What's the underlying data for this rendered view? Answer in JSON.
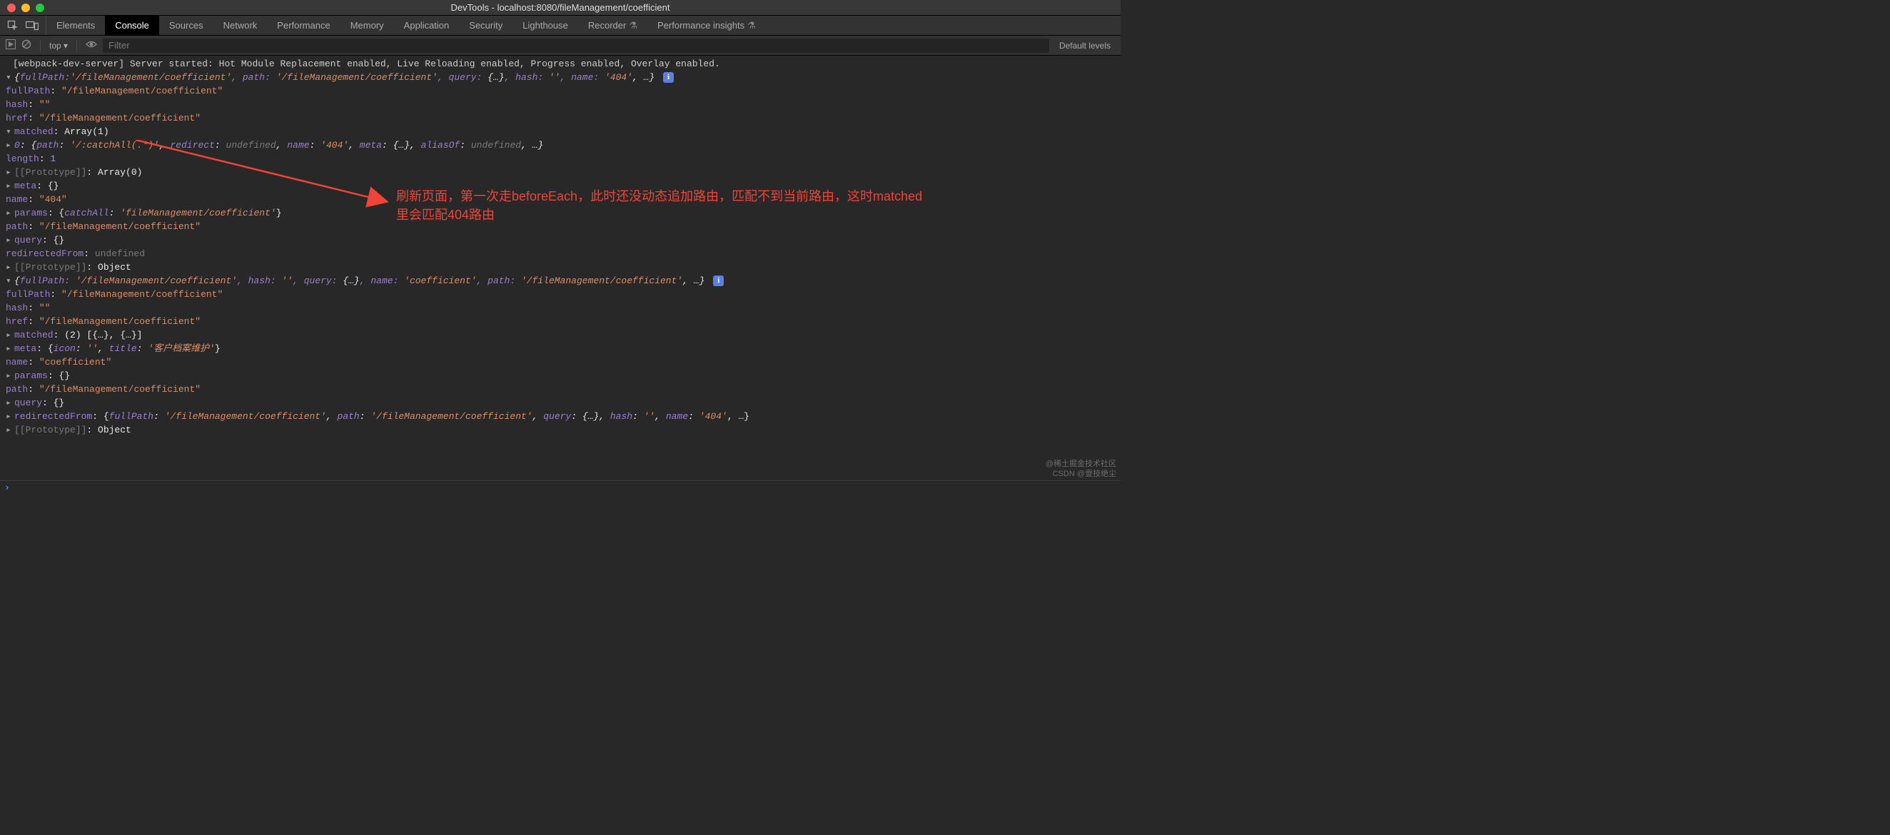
{
  "window": {
    "title": "DevTools - localhost:8080/fileManagement/coefficient"
  },
  "tabs": {
    "items": [
      {
        "label": "Elements"
      },
      {
        "label": "Console",
        "active": true
      },
      {
        "label": "Sources"
      },
      {
        "label": "Network"
      },
      {
        "label": "Performance"
      },
      {
        "label": "Memory"
      },
      {
        "label": "Application"
      },
      {
        "label": "Security"
      },
      {
        "label": "Lighthouse"
      },
      {
        "label": "Recorder",
        "flask": true
      },
      {
        "label": "Performance insights",
        "flask": true
      }
    ]
  },
  "toolbar": {
    "context": "top",
    "filter_placeholder": "Filter",
    "levels": "Default levels"
  },
  "log": {
    "server_msg": "[webpack-dev-server] Server started: Hot Module Replacement enabled, Live Reloading enabled, Progress enabled, Overlay enabled.",
    "obj1": {
      "summary_pre": "{",
      "summary_parts": {
        "fullPath_k": "fullPath:",
        "fullPath_v": "'/fileManagement/coefficient'",
        "path_k": ", path:",
        "path_v": " '/fileManagement/coefficient'",
        "query_k": ", query:",
        "query_v": " {…}",
        "hash_k": ", hash:",
        "hash_v": " ''",
        "name_k": ", name:",
        "name_v": " '404'",
        "tail": ", …}"
      },
      "fullPath_k": "fullPath",
      "fullPath_v": "\"/fileManagement/coefficient\"",
      "hash_k": "hash",
      "hash_v": "\"\"",
      "href_k": "href",
      "href_v": "\"/fileManagement/coefficient\"",
      "matched_k": "matched",
      "matched_v": "Array(1)",
      "matched0": {
        "idx": "0",
        "path_k": "path",
        "path_v": "'/:catchAll(.*)'",
        "redirect_k": "redirect",
        "redirect_v": "undefined",
        "name_k": "name",
        "name_v": "'404'",
        "meta_k": "meta",
        "meta_v": "{…}",
        "aliasOf_k": "aliasOf",
        "aliasOf_v": "undefined",
        "tail": ", …}"
      },
      "length_k": "length",
      "length_v": "1",
      "proto_arr_k": "[[Prototype]]",
      "proto_arr_v": "Array(0)",
      "meta_k": "meta",
      "meta_v": "{}",
      "name_k": "name",
      "name_v": "\"404\"",
      "params_k": "params",
      "params_pre": "{",
      "params_ck": "catchAll",
      "params_cv": "'fileManagement/coefficient'",
      "params_post": "}",
      "path_k": "path",
      "path_v": "\"/fileManagement/coefficient\"",
      "query_k": "query",
      "query_v": "{}",
      "redir_k": "redirectedFrom",
      "redir_v": "undefined",
      "proto_k": "[[Prototype]]",
      "proto_v": "Object"
    },
    "obj2": {
      "summary_parts": {
        "fullPath_k": "fullPath:",
        "fullPath_v": " '/fileManagement/coefficient'",
        "hash_k": ", hash:",
        "hash_v": " ''",
        "query_k": ", query:",
        "query_v": " {…}",
        "name_k": ", name:",
        "name_v": " 'coefficient'",
        "path_k": ", path:",
        "path_v": " '/fileManagement/coefficient'",
        "tail": ", …}"
      },
      "fullPath_k": "fullPath",
      "fullPath_v": "\"/fileManagement/coefficient\"",
      "hash_k": "hash",
      "hash_v": "\"\"",
      "href_k": "href",
      "href_v": "\"/fileManagement/coefficient\"",
      "matched_k": "matched",
      "matched_v": "(2) [{…}, {…}]",
      "meta_k": "meta",
      "meta_pre": "{",
      "meta_icon_k": "icon",
      "meta_icon_v": "''",
      "meta_title_k": "title",
      "meta_title_v": "'客户档案维护'",
      "meta_post": "}",
      "name_k": "name",
      "name_v": "\"coefficient\"",
      "params_k": "params",
      "params_v": "{}",
      "path_k": "path",
      "path_v": "\"/fileManagement/coefficient\"",
      "query_k": "query",
      "query_v": "{}",
      "redir_k": "redirectedFrom",
      "redir_pre": "{",
      "r_fullPath_k": "fullPath",
      "r_fullPath_v": "'/fileManagement/coefficient'",
      "r_path_k": "path",
      "r_path_v": "'/fileManagement/coefficient'",
      "r_query_k": "query",
      "r_query_v": "{…}",
      "r_hash_k": "hash",
      "r_hash_v": "''",
      "r_name_k": "name",
      "r_name_v": "'404'",
      "r_tail": ", …}",
      "proto_k": "[[Prototype]]",
      "proto_v": "Object"
    }
  },
  "annotation": {
    "line1": "刷新页面，第一次走beforeEach，此时还没动态追加路由，匹配不到当前路由，这时matched",
    "line2": "里会匹配404路由"
  },
  "watermark": {
    "line1": "@稀土掘金技术社区",
    "line2": "CSDN @壹技绝尘"
  },
  "icons": {
    "inspect": "inspect-icon",
    "device": "device-toolbar-icon",
    "play": "play-icon",
    "clear": "clear-icon",
    "eye": "eye-icon",
    "info": "i"
  }
}
